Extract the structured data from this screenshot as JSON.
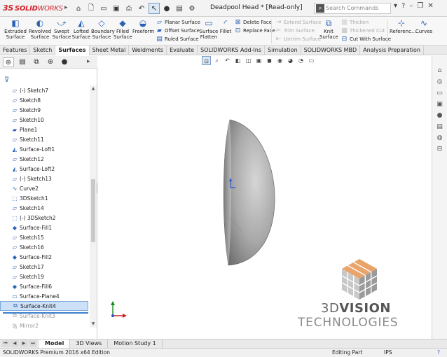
{
  "titlebar": {
    "brand_ds": "3S",
    "brand_solid": "SOLID",
    "brand_works": "WORKS",
    "document_title": "Deadpool Head * [Read-only]",
    "search_placeholder": "Search Commands",
    "quick_access_icons": [
      "home-icon",
      "new-document-icon",
      "open-folder-icon",
      "save-icon",
      "print-icon",
      "undo-icon",
      "select-arrow-icon",
      "rebuild-icon",
      "file-properties-icon",
      "options-gear-icon"
    ]
  },
  "ribbon": {
    "extruded": "Extruded Surface",
    "revolved": "Revolved Surface",
    "swept": "Swept Surface",
    "lofted": "Lofted Surface",
    "boundary": "Boundary Surface",
    "filled": "Filled Surface",
    "freeform": "Freeform",
    "planar": "Planar Surface",
    "offset": "Offset Surface",
    "ruled": "Ruled Surface",
    "flatten": "Surface Flatten",
    "fillet": "Fillet",
    "delete_face": "Delete Face",
    "replace_face": "Replace Face",
    "extend": "Extend Surface",
    "trim": "Trim Surface",
    "untrim": "Untrim Surface",
    "knit": "Knit Surface",
    "thicken": "Thicken",
    "thickened_cut": "Thickened Cut",
    "cut_with_surface": "Cut With Surface",
    "reference": "Referenc...",
    "curves": "Curves"
  },
  "command_tabs": [
    "Features",
    "Sketch",
    "Surfaces",
    "Sheet Metal",
    "Weldments",
    "Evaluate",
    "SOLIDWORKS Add-Ins",
    "Simulation",
    "SOLIDWORKS MBD",
    "Analysis Preparation"
  ],
  "active_command_tab": "Surfaces",
  "feature_tree": [
    {
      "label": "(-) Sketch7",
      "icon": "sketch-icon",
      "state": "normal"
    },
    {
      "label": "Sketch8",
      "icon": "sketch-icon",
      "state": "normal"
    },
    {
      "label": "Sketch9",
      "icon": "sketch-icon",
      "state": "normal"
    },
    {
      "label": "Sketch10",
      "icon": "sketch-icon",
      "state": "normal"
    },
    {
      "label": "Plane1",
      "icon": "plane-icon",
      "state": "normal"
    },
    {
      "label": "Sketch11",
      "icon": "sketch-icon",
      "state": "normal"
    },
    {
      "label": "Surface-Loft1",
      "icon": "surface-loft-icon",
      "state": "normal"
    },
    {
      "label": "Sketch12",
      "icon": "sketch-icon",
      "state": "normal"
    },
    {
      "label": "Surface-Loft2",
      "icon": "surface-loft-icon",
      "state": "normal"
    },
    {
      "label": "(-) Sketch13",
      "icon": "sketch-icon",
      "state": "normal"
    },
    {
      "label": "Curve2",
      "icon": "curve-icon",
      "state": "normal"
    },
    {
      "label": "3DSketch1",
      "icon": "3d-sketch-icon",
      "state": "normal"
    },
    {
      "label": "Sketch14",
      "icon": "sketch-icon",
      "state": "normal"
    },
    {
      "label": "(-) 3DSketch2",
      "icon": "3d-sketch-icon",
      "state": "normal"
    },
    {
      "label": "Surface-Fill1",
      "icon": "surface-fill-icon",
      "state": "normal"
    },
    {
      "label": "Sketch15",
      "icon": "sketch-icon",
      "state": "normal"
    },
    {
      "label": "Sketch16",
      "icon": "sketch-icon",
      "state": "normal"
    },
    {
      "label": "Surface-Fill2",
      "icon": "surface-fill-icon",
      "state": "normal"
    },
    {
      "label": "Sketch17",
      "icon": "sketch-icon",
      "state": "normal"
    },
    {
      "label": "Sketch19",
      "icon": "sketch-icon",
      "state": "normal"
    },
    {
      "label": "Surface-Fill6",
      "icon": "surface-fill-icon",
      "state": "normal"
    },
    {
      "label": "Surface-Plane4",
      "icon": "surface-plane-icon",
      "state": "normal"
    },
    {
      "label": "Surface-Knit4",
      "icon": "surface-knit-icon",
      "state": "selected"
    },
    {
      "label": "Surface-Knit3",
      "icon": "surface-knit-icon",
      "state": "suppressed"
    },
    {
      "label": "Mirror2",
      "icon": "mirror-icon",
      "state": "suppressed"
    }
  ],
  "watermark": {
    "line1_a": "3D",
    "line1_b": "VISION",
    "line2": "TECHNOLOGIES",
    "colors": [
      "#e8a46a",
      "#c8c8c8",
      "#9a9a9a"
    ]
  },
  "bottom_tabs": [
    "Model",
    "3D Views",
    "Motion Study 1"
  ],
  "active_bottom_tab": "Model",
  "status": {
    "product": "SOLIDWORKS Premium 2016 x64 Edition",
    "mode": "Editing Part",
    "units": "IPS",
    "help": "?"
  },
  "colors": {
    "accent": "#2a63b4",
    "brand_red": "#d2232a",
    "selection": "#cce0f7"
  }
}
